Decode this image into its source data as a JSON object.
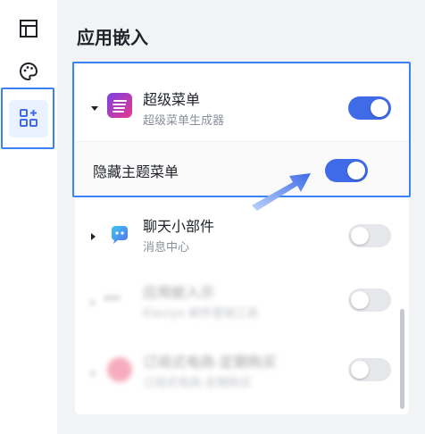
{
  "leftbar": {
    "icons": [
      {
        "name": "layout-icon"
      },
      {
        "name": "palette-icon"
      },
      {
        "name": "apps-add-icon"
      }
    ]
  },
  "main": {
    "title": "应用嵌入",
    "items": [
      {
        "title": "超级菜单",
        "subtitle": "超级菜单生成器",
        "enabled": true,
        "expanded": true,
        "sub_option": {
          "label": "隐藏主题菜单",
          "enabled": true
        }
      },
      {
        "title": "聊天小部件",
        "subtitle": "消息中心",
        "enabled": false,
        "expanded": false
      },
      {
        "title": "应用嵌入示",
        "subtitle": "Klaviyo 邮件营销工具",
        "enabled": false,
        "blurred": true
      },
      {
        "title": "订阅式电商-定期购买",
        "subtitle": "订阅式电商-定期购买",
        "enabled": false,
        "blurred": true
      }
    ]
  },
  "colors": {
    "accent": "#3f6be8",
    "highlight_frame": "#3b82f6",
    "toggle_off": "#e6e7eb",
    "arrow": "#5b8def"
  }
}
